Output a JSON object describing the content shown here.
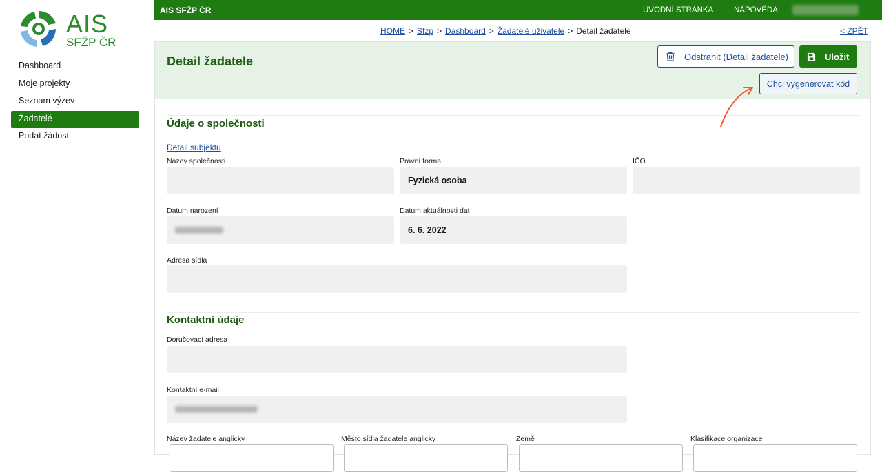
{
  "logo": {
    "title": "AIS",
    "subtitle": "SFŽP ČR"
  },
  "sidebar": {
    "items": [
      {
        "label": "Dashboard",
        "active": false
      },
      {
        "label": "Moje projekty",
        "active": false
      },
      {
        "label": "Seznam výzev",
        "active": false
      },
      {
        "label": "Žadatelé",
        "active": true
      },
      {
        "label": "Podat žádost",
        "active": false
      }
    ]
  },
  "topbar": {
    "brand": "AIS SFŽP ČR",
    "home": "ÚVODNÍ STRÁNKA",
    "help": "NÁPOVĚDA"
  },
  "breadcrumb": {
    "home": "HOME",
    "sfzp": "Sfzp",
    "dashboard": "Dashboard",
    "users": "Žadatelé uživatele",
    "current": "Detail žadatele",
    "back": "< ZPĚT"
  },
  "header": {
    "title": "Detail žadatele",
    "delete_label": "Odstranit (Detail žadatele)",
    "save_label": "Uložit",
    "generate_label": "Chci vygenerovat kód"
  },
  "company": {
    "section_title": "Údaje o společnosti",
    "detail_link": "Detail subjektu",
    "name_label": "Název společnosti",
    "name_value": "",
    "legal_form_label": "Právní forma",
    "legal_form_value": "Fyzická osoba",
    "ico_label": "IČO",
    "ico_value": "",
    "birth_label": "Datum narození",
    "update_label": "Datum aktuálnosti dat",
    "update_value": "6. 6. 2022",
    "address_label": "Adresa sídla",
    "address_value": ""
  },
  "contact": {
    "section_title": "Kontaktní údaje",
    "delivery_label": "Doručovací adresa",
    "delivery_value": "",
    "email_label": "Kontaktní e-mail",
    "name_en_label": "Název žadatele anglicky",
    "city_en_label": "Město sídla žadatele anglicky",
    "country_label": "Země",
    "classification_label": "Klasifikace organizace"
  },
  "colors": {
    "brand_green": "#1e7c10",
    "link_blue": "#1e4f9c",
    "header_bg": "#e5f2e5",
    "arrow": "#f05a28"
  }
}
